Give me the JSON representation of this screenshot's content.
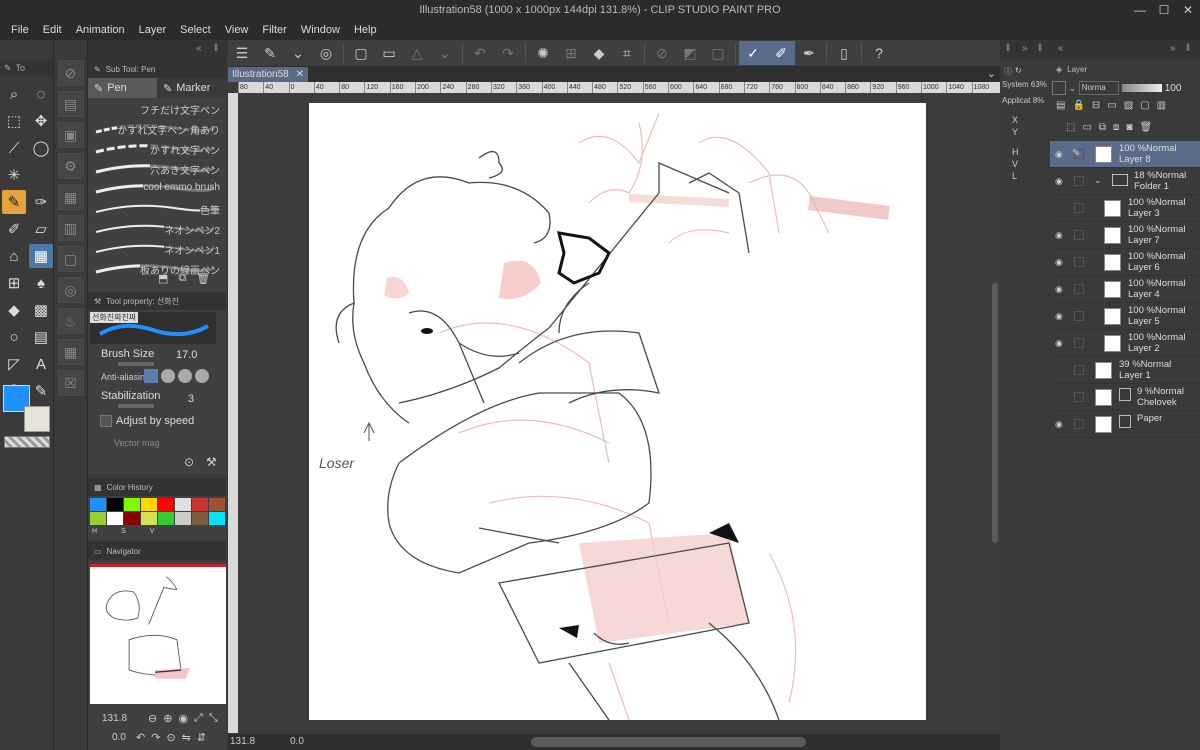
{
  "window": {
    "title": "Illustration58 (1000 x 1000px 144dpi 131.8%)  - CLIP STUDIO PAINT PRO"
  },
  "menu": [
    "File",
    "Edit",
    "Animation",
    "Layer",
    "Select",
    "View",
    "Filter",
    "Window",
    "Help"
  ],
  "tools_header": "To",
  "subtool": {
    "header": "Sub Tool: Pen",
    "tabs": [
      "Pen",
      "Marker"
    ],
    "brushes": [
      "フチだけ文字ペン",
      "かすれ文字ペン 角あり",
      "かすれ文字ペン",
      "穴あき文字ペン",
      "cool emmo brush",
      "色筆",
      "ネオンペン2",
      "ネオンペン1",
      "板ありの線画ペン"
    ]
  },
  "toolprop": {
    "header": "Tool property: 선화진",
    "preset_label": "선화진짜진짜",
    "brush_size_label": "Brush Size",
    "brush_size_value": "17.0",
    "antialias_label": "Anti-aliasing",
    "stabilization_label": "Stabilization",
    "stabilization_value": "3",
    "adjust_label": "Adjust by speed",
    "vector_label": "Vector mag"
  },
  "colorhistory": {
    "header": "Color History",
    "swatches": [
      "#1e90ff",
      "#000000",
      "#7cfc00",
      "#ffd700",
      "#ff0000",
      "#e0e0e0",
      "#cc3333",
      "#a0522d",
      "#9acd32",
      "#ffffff",
      "#8b0000",
      "#d4e157",
      "#32cd32",
      "#cccccc",
      "#7b5c3b",
      "#00e5ff"
    ],
    "footer": [
      "H",
      "S",
      "V"
    ]
  },
  "navigator": {
    "header": "Navigator",
    "zoom": "131.8",
    "angle": "0.0"
  },
  "document": {
    "tab": "Illustration58",
    "ruler_ticks": [
      "80",
      "40",
      "0",
      "40",
      "80",
      "120",
      "160",
      "200",
      "240",
      "280",
      "320",
      "360",
      "400",
      "440",
      "480",
      "520",
      "560",
      "600",
      "640",
      "680",
      "720",
      "760",
      "800",
      "840",
      "880",
      "920",
      "960",
      "1000",
      "1040",
      "1080"
    ]
  },
  "status": {
    "zoom": "131.8",
    "angle": "0.0"
  },
  "canvas_annotation": "Loser",
  "info": {
    "system_label": "System",
    "system_value": "63%",
    "app_label": "Applicat",
    "app_value": "8%",
    "coords": [
      "X",
      "Y",
      "H",
      "V",
      "L"
    ]
  },
  "layers": {
    "header": "Layer",
    "blend": "Norma",
    "opacity": "100",
    "items": [
      {
        "line1": "100 %Normal",
        "line2": "Layer 8",
        "selected": true,
        "indent": 0
      },
      {
        "line1": "18 %Normal",
        "line2": "Folder 1",
        "selected": false,
        "indent": 0
      },
      {
        "line1": "100 %Normal",
        "line2": "Layer 3",
        "selected": false,
        "indent": 1
      },
      {
        "line1": "100 %Normal",
        "line2": "Layer 7",
        "selected": false,
        "indent": 1
      },
      {
        "line1": "100 %Normal",
        "line2": "Layer 6",
        "selected": false,
        "indent": 1
      },
      {
        "line1": "100 %Normal",
        "line2": "Layer 4",
        "selected": false,
        "indent": 1
      },
      {
        "line1": "100 %Normal",
        "line2": "Layer 5",
        "selected": false,
        "indent": 1
      },
      {
        "line1": "100 %Normal",
        "line2": "Layer 2",
        "selected": false,
        "indent": 1
      },
      {
        "line1": "39 %Normal",
        "line2": "Layer 1",
        "selected": false,
        "indent": 0
      },
      {
        "line1": "9 %Normal",
        "line2": "Chelovek",
        "selected": false,
        "indent": 0
      },
      {
        "line1": "",
        "line2": "Paper",
        "selected": false,
        "indent": 0
      }
    ]
  }
}
